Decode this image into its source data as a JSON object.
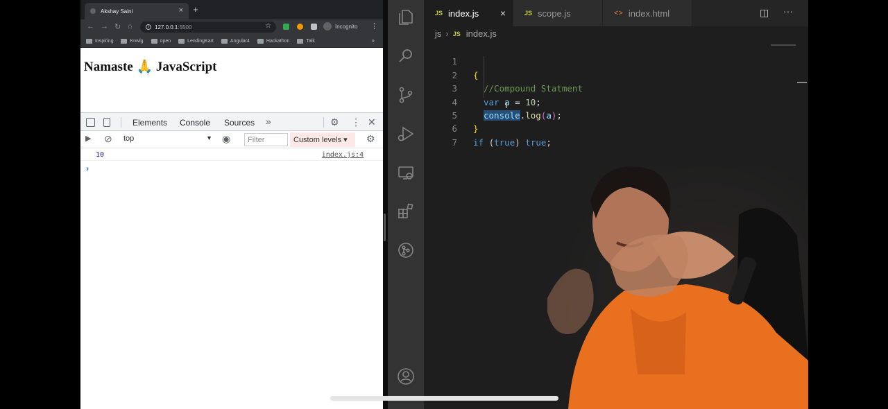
{
  "browser": {
    "tab_title": "Akshay Saini",
    "tab_close": "×",
    "new_tab": "+",
    "url_host": "127.0.0.1",
    "url_port": ":5500",
    "incognito_label": "Incognito",
    "bookmarks": [
      "Inspiring",
      "Knwlg",
      "open",
      "LendingKart",
      "Angular4",
      "Hackathon",
      "Talk"
    ],
    "bookmarks_more": "»",
    "page_heading": "Namaste 🙏 JavaScript"
  },
  "devtools": {
    "tabs": [
      "Elements",
      "Console",
      "Sources"
    ],
    "active_tab": "Console",
    "more_tabs": "»",
    "context": "top",
    "filter_placeholder": "Filter",
    "levels": "Custom levels ▾",
    "log_value": "10",
    "log_source": "index.js:4",
    "prompt": "›"
  },
  "editor": {
    "tabs": [
      {
        "label": "index.js",
        "kind": "JS",
        "active": true
      },
      {
        "label": "scope.js",
        "kind": "JS",
        "active": false
      },
      {
        "label": "index.html",
        "kind": "<>",
        "active": false
      }
    ],
    "tab_close": "×",
    "breadcrumb": [
      "js",
      "index.js"
    ],
    "breadcrumb_badge": "JS",
    "line_numbers": [
      "1",
      "2",
      "3",
      "4",
      "5",
      "6",
      "7"
    ],
    "code": {
      "l1_brace": "{",
      "l2_comment": "//Compound Statment",
      "l3_kw": "var",
      "l3_var": "a",
      "l3_op": " = ",
      "l3_num": "10",
      "l3_end": ";",
      "l4_obj": "console",
      "l4_dot": ".",
      "l4_fn": "log",
      "l4_open": "(",
      "l4_arg": "a",
      "l4_close": ")",
      "l4_end": ";",
      "l5_brace": "}",
      "l6_kw": "if",
      "l6_open": " (",
      "l6_cond": "true",
      "l6_close": ") ",
      "l6_body": "true",
      "l6_end": ";"
    }
  },
  "colors": {
    "editor_bg": "#1e1e1e",
    "activity_bar": "#333333",
    "devtools_accent": "#1a73e8",
    "js_badge": "#cbcb41",
    "shirt_orange": "#e8701e"
  },
  "icons": [
    "files-icon",
    "search-icon",
    "source-control-icon",
    "run-debug-icon",
    "remote-explorer-icon",
    "extensions-icon",
    "git-graph-icon",
    "account-icon",
    "split-editor-icon",
    "more-actions-icon"
  ]
}
